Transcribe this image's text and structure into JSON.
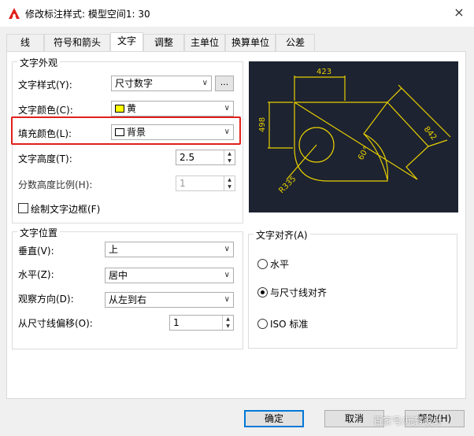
{
  "window": {
    "title": "修改标注样式: 模型空间1: 30",
    "close": "×"
  },
  "tabs": [
    {
      "label": "线"
    },
    {
      "label": "符号和箭头"
    },
    {
      "label": "文字"
    },
    {
      "label": "调整"
    },
    {
      "label": "主单位"
    },
    {
      "label": "换算单位"
    },
    {
      "label": "公差"
    }
  ],
  "text_appearance": {
    "legend": "文字外观",
    "style_label": "文字样式(Y):",
    "style_value": "尺寸数字",
    "style_button": "...",
    "color_label": "文字颜色(C):",
    "color_value": "黄",
    "fill_label": "填充颜色(L):",
    "fill_value": "背景",
    "height_label": "文字高度(T):",
    "height_value": "2.5",
    "fraction_label": "分数高度比例(H):",
    "fraction_value": "1",
    "frame_label": "绘制文字边框(F)"
  },
  "text_placement": {
    "legend": "文字位置",
    "vertical_label": "垂直(V):",
    "vertical_value": "上",
    "horizontal_label": "水平(Z):",
    "horizontal_value": "居中",
    "view_label": "观察方向(D):",
    "view_value": "从左到右",
    "offset_label": "从尺寸线偏移(O):",
    "offset_value": "1"
  },
  "text_alignment": {
    "legend": "文字对齐(A)",
    "options": [
      {
        "label": "水平",
        "checked": false
      },
      {
        "label": "与尺寸线对齐",
        "checked": true
      },
      {
        "label": "ISO 标准",
        "checked": false
      }
    ]
  },
  "preview": {
    "dim_top": "423",
    "dim_left": "498",
    "dim_right": "842",
    "dim_angle": "60°",
    "dim_radius": "R335"
  },
  "buttons": {
    "ok": "确定",
    "cancel": "取消",
    "help": "帮助(H)"
  },
  "watermark": "百家号/玩转设计",
  "colors": {
    "preview_bg": "#1d2331",
    "dimension_yellow": "#e8d000",
    "highlight_red": "#e0201b",
    "swatch_yellow": "#ffff00"
  }
}
